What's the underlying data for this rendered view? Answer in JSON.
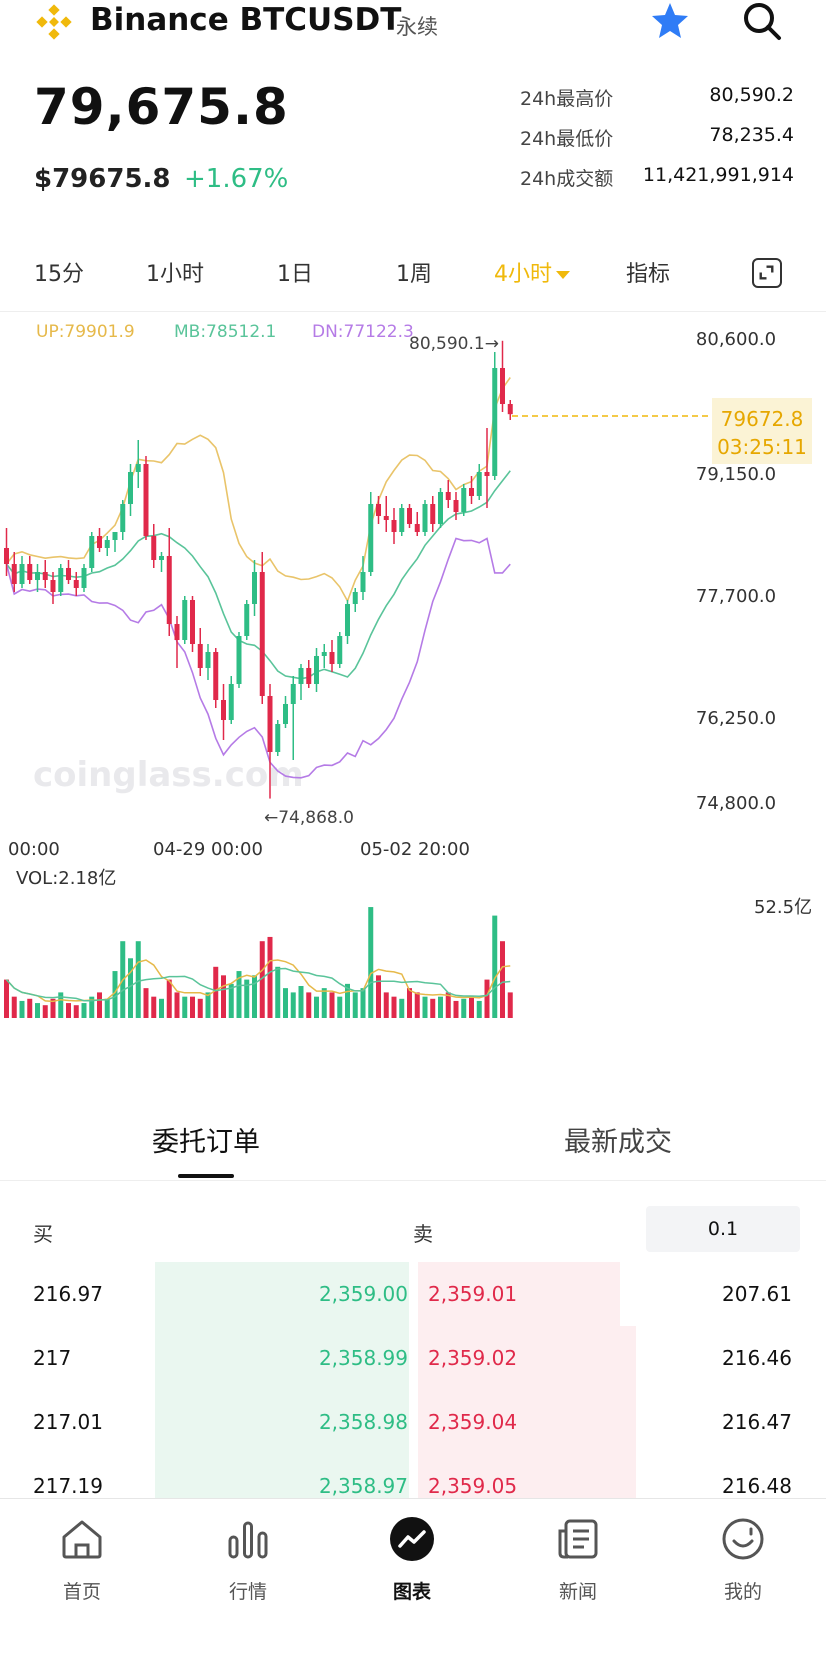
{
  "header": {
    "title": "Binance BTCUSDT",
    "subtitle": "永续",
    "icons": [
      "binance-logo",
      "star-icon",
      "search-icon"
    ],
    "accent_color": "#f0b90b",
    "star_color": "#2f7cf6"
  },
  "price": {
    "last": "79,675.8",
    "usd": "$79675.8",
    "change": "+1.67%"
  },
  "stats": [
    {
      "label": "24h最高价",
      "value": "80,590.2"
    },
    {
      "label": "24h最低价",
      "value": "78,235.4"
    },
    {
      "label": "24h成交额",
      "value": "11,421,991,914"
    }
  ],
  "timeframes": {
    "items": [
      "15分",
      "1小时",
      "1日",
      "1周",
      "4小时",
      "指标"
    ],
    "active": "4小时"
  },
  "chart": {
    "boll_up": "UP:79901.9",
    "boll_mb": "MB:78512.1",
    "boll_dn": "DN:77122.3",
    "y_ticks": [
      "80,600.0",
      "79,150.0",
      "77,700.0",
      "76,250.0",
      "74,800.0"
    ],
    "current_price": "79672.8",
    "countdown": "03:25:11",
    "high_label": "80,590.1→",
    "low_label": "←74,868.0",
    "x_ticks": [
      "00:00",
      "04-29 00:00",
      "05-02 20:00"
    ],
    "watermark": "coinglass.com",
    "vol_label": "VOL:2.18亿",
    "vol_max": "52.5亿",
    "colors": {
      "up": "#2ebd85",
      "down": "#e0294a",
      "boll_up": "#e9c46a",
      "boll_mb": "#5ac49a",
      "boll_dn": "#b57be6"
    }
  },
  "chart_data": {
    "type": "candlestick",
    "title": "",
    "ylim": [
      74000,
      80800
    ],
    "y_ticks": [
      80600.0,
      79150.0,
      77700.0,
      76250.0,
      74800.0
    ],
    "x_ticks": [
      "00:00",
      "04-29 00:00",
      "05-02 20:00"
    ],
    "indicators": {
      "UP": 79901.9,
      "MB": 78512.1,
      "DN": 77122.3,
      "VOL": "2.18亿"
    },
    "high": 80590.1,
    "low": 74868.0,
    "last": 79672.8,
    "candles": [
      [
        78000,
        78250,
        77650,
        77800
      ],
      [
        77800,
        77950,
        77450,
        77550
      ],
      [
        77550,
        77900,
        77500,
        77800
      ],
      [
        77800,
        77900,
        77550,
        77600
      ],
      [
        77600,
        77800,
        77450,
        77700
      ],
      [
        77700,
        77850,
        77500,
        77600
      ],
      [
        77600,
        77700,
        77300,
        77450
      ],
      [
        77450,
        77800,
        77400,
        77750
      ],
      [
        77750,
        77850,
        77550,
        77600
      ],
      [
        77600,
        77700,
        77400,
        77500
      ],
      [
        77500,
        77800,
        77450,
        77750
      ],
      [
        77750,
        78200,
        77700,
        78150
      ],
      [
        78150,
        78250,
        77950,
        78000
      ],
      [
        78000,
        78150,
        77900,
        78100
      ],
      [
        78100,
        78200,
        77950,
        78200
      ],
      [
        78200,
        78600,
        78100,
        78550
      ],
      [
        78550,
        79050,
        78400,
        78950
      ],
      [
        78950,
        79350,
        78750,
        79050
      ],
      [
        79050,
        79150,
        78100,
        78150
      ],
      [
        78150,
        78300,
        77750,
        77850
      ],
      [
        77850,
        77950,
        77700,
        77900
      ],
      [
        77900,
        78250,
        76900,
        77050
      ],
      [
        77050,
        77150,
        76500,
        76850
      ],
      [
        76850,
        77400,
        76800,
        77350
      ],
      [
        77350,
        77400,
        76700,
        76800
      ],
      [
        76800,
        77000,
        76400,
        76500
      ],
      [
        76500,
        76800,
        76350,
        76700
      ],
      [
        76700,
        76750,
        76000,
        76100
      ],
      [
        76100,
        76300,
        75600,
        75850
      ],
      [
        75850,
        76400,
        75800,
        76300
      ],
      [
        76300,
        76950,
        76250,
        76900
      ],
      [
        76900,
        77350,
        76850,
        77300
      ],
      [
        77300,
        77850,
        77150,
        77700
      ],
      [
        77700,
        77950,
        76050,
        76150
      ],
      [
        76150,
        76300,
        74868,
        75450
      ],
      [
        75450,
        75850,
        75400,
        75800
      ],
      [
        75800,
        76150,
        75750,
        76050
      ],
      [
        76050,
        76400,
        75350,
        76300
      ],
      [
        76300,
        76550,
        76100,
        76500
      ],
      [
        76500,
        76600,
        76250,
        76300
      ],
      [
        76300,
        76750,
        76200,
        76650
      ],
      [
        76650,
        76800,
        76500,
        76700
      ],
      [
        76700,
        76850,
        76450,
        76550
      ],
      [
        76550,
        76950,
        76500,
        76900
      ],
      [
        76900,
        77350,
        76800,
        77300
      ],
      [
        77300,
        77500,
        77200,
        77450
      ],
      [
        77450,
        77900,
        77350,
        77700
      ],
      [
        77700,
        78700,
        77650,
        78550
      ],
      [
        78550,
        78650,
        78300,
        78400
      ],
      [
        78400,
        78650,
        78200,
        78350
      ],
      [
        78350,
        78500,
        78050,
        78200
      ],
      [
        78200,
        78550,
        78150,
        78500
      ],
      [
        78500,
        78550,
        78250,
        78300
      ],
      [
        78300,
        78450,
        78150,
        78200
      ],
      [
        78200,
        78600,
        78150,
        78550
      ],
      [
        78550,
        78650,
        78200,
        78300
      ],
      [
        78300,
        78750,
        78250,
        78700
      ],
      [
        78700,
        78850,
        78500,
        78600
      ],
      [
        78600,
        78700,
        78350,
        78450
      ],
      [
        78450,
        78800,
        78400,
        78750
      ],
      [
        78750,
        78900,
        78550,
        78650
      ],
      [
        78650,
        79050,
        78600,
        78950
      ],
      [
        78950,
        79500,
        78500,
        78900
      ],
      [
        78900,
        80450,
        78850,
        80250
      ],
      [
        80250,
        80590.1,
        79700,
        79800
      ],
      [
        79800,
        79850,
        79600,
        79672.8
      ]
    ],
    "volume": [
      18,
      10,
      8,
      9,
      7,
      6,
      9,
      12,
      7,
      6,
      7,
      10,
      12,
      9,
      22,
      36,
      28,
      36,
      14,
      10,
      9,
      18,
      12,
      10,
      10,
      9,
      12,
      24,
      20,
      16,
      22,
      18,
      20,
      36,
      38,
      24,
      14,
      12,
      15,
      12,
      10,
      14,
      12,
      10,
      16,
      12,
      14,
      52,
      20,
      12,
      10,
      9,
      14,
      12,
      10,
      9,
      10,
      12,
      8,
      9,
      10,
      8,
      18,
      48,
      36,
      12
    ]
  },
  "order_tabs": {
    "items": [
      "委托订单",
      "最新成交"
    ],
    "active": "委托订单"
  },
  "orderbook": {
    "buy_label": "买",
    "sell_label": "卖",
    "precision": "0.1",
    "rows": [
      {
        "bid_qty": "216.97",
        "bid_px": "2,359.00",
        "ask_px": "2,359.01",
        "ask_qty": "207.61",
        "ask_depth": 0.91
      },
      {
        "bid_qty": "217",
        "bid_px": "2,358.99",
        "ask_px": "2,359.02",
        "ask_qty": "216.46",
        "ask_depth": 0.98
      },
      {
        "bid_qty": "217.01",
        "bid_px": "2,358.98",
        "ask_px": "2,359.04",
        "ask_qty": "216.47",
        "ask_depth": 0.98
      },
      {
        "bid_qty": "217.19",
        "bid_px": "2,358.97",
        "ask_px": "2,359.05",
        "ask_qty": "216.48",
        "ask_depth": 0.98
      }
    ]
  },
  "bottom_nav": {
    "items": [
      {
        "label": "首页",
        "icon": "home-icon"
      },
      {
        "label": "行情",
        "icon": "market-icon"
      },
      {
        "label": "图表",
        "icon": "chart-icon"
      },
      {
        "label": "新闻",
        "icon": "news-icon"
      },
      {
        "label": "我的",
        "icon": "profile-icon"
      }
    ],
    "active": "图表"
  }
}
